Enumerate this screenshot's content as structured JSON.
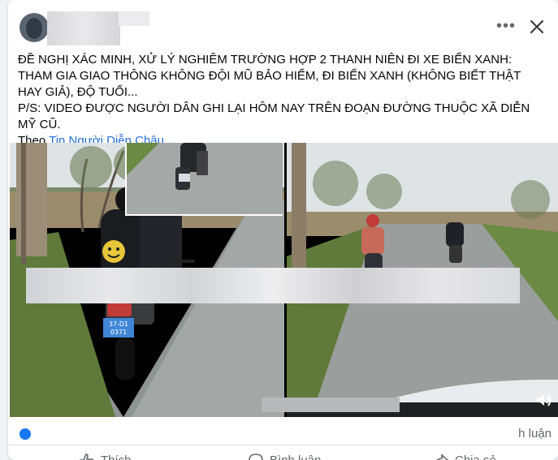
{
  "post": {
    "line1": "ĐỀ NGHỊ XÁC MINH, XỬ LÝ NGHIÊM TRƯỜNG HỢP 2 THANH NIÊN ĐI XE BIỂN XANH: THAM GIA GIAO THÔNG KHÔNG ĐỘI MŨ BẢO HIỂM, ĐI BIỂN XANH (KHÔNG BIẾT THẬT HAY GIẢ), ĐỘ TUỔI...",
    "line2": "P/S: VIDEO ĐƯỢC NGƯỜI DÂN GHI LẠI HÔM NAY TRÊN ĐOẠN ĐƯỜNG THUỘC XÃ DIỄN MỸ CŨ.",
    "source_prefix": "Theo",
    "source_link": "Tin Người Diễn Châu"
  },
  "media": {
    "plate_text": "37-D1\n0371"
  },
  "stats": {
    "comments_partial": "h luận"
  },
  "actions": {
    "like": "Thích",
    "comment": "Bình luận",
    "share": "Chia sẻ"
  },
  "icons": [
    "more-icon",
    "close-icon",
    "volume-icon",
    "like-icon",
    "comment-icon",
    "share-icon"
  ],
  "colors": {
    "link": "#216fdb",
    "text": "#050505",
    "muted": "#65676b"
  }
}
